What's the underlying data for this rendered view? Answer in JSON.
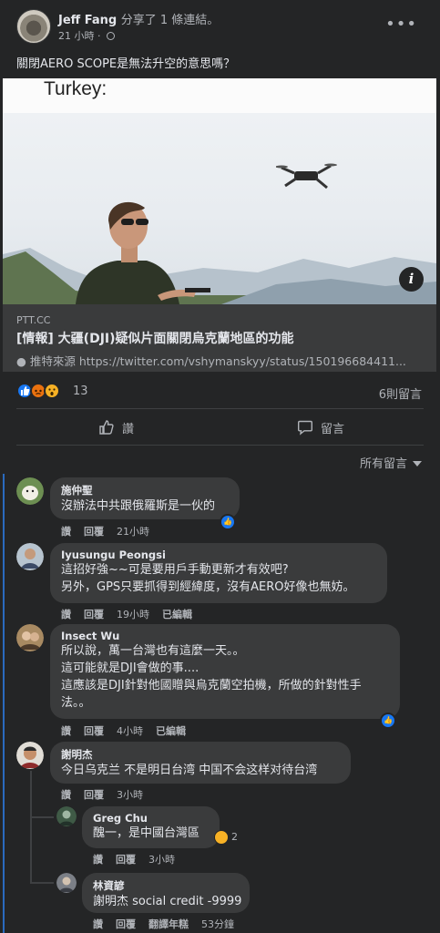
{
  "post": {
    "author": "Jeff Fang",
    "shared_text": "分享了 1 條連結。",
    "time": "21 小時",
    "text": "關閉AERO SCOPE是無法升空的意思嗎？"
  },
  "link": {
    "image_caption": "Turkey:",
    "domain": "PTT.CC",
    "title": "[情報] 大疆(DJI)疑似片面關閉烏克蘭地區的功能",
    "description": "● 推特來源 https://twitter.com/vshymanskyy/status/150196684411..."
  },
  "stats": {
    "reaction_count": "13",
    "comment_count": "6則留言"
  },
  "actions": {
    "like_label": "讚",
    "comment_label": "留言",
    "sort_label": "所有留言"
  },
  "comments": [
    {
      "name": "施仲聖",
      "lines": [
        "沒辦法中共跟俄羅斯是一伙的"
      ],
      "like": "讚",
      "reply": "回覆",
      "time": "21小時"
    },
    {
      "name": "Iyusungu Peongsi",
      "lines": [
        "這招好強~~可是要用戶手動更新才有效吧?",
        "另外，GPS只要抓得到經緯度，沒有AERO好像也無妨。"
      ],
      "like": "讚",
      "reply": "回覆",
      "time": "19小時",
      "edited": "已編輯"
    },
    {
      "name": "Insect Wu",
      "lines": [
        "所以說，萬一台灣也有這麼一天。。",
        "這可能就是DJI會做的事....",
        "這應該是DJI針對他國贈與烏克蘭空拍機，所做的針對性手",
        "法。。"
      ],
      "like": "讚",
      "reply": "回覆",
      "time": "4小時",
      "edited": "已編輯"
    },
    {
      "name": "謝明杰",
      "lines": [
        "今日乌克兰 不是明日台湾 中国不会这样对待台湾"
      ],
      "like": "讚",
      "reply": "回覆",
      "time": "3小時"
    },
    {
      "name": "Greg Chu",
      "lines": [
        "醜一，是中國台灣區"
      ],
      "like": "讚",
      "reply": "回覆",
      "time": "3小時",
      "reaction_count": "2"
    },
    {
      "name": "林資諺",
      "lines": [
        "謝明杰 social credit -9999"
      ],
      "like": "讚",
      "reply": "回覆",
      "translate": "翻譯年糕",
      "time": "53分鐘"
    }
  ],
  "colors": {
    "background": "#242526",
    "bubble": "#3a3b3c",
    "accent": "#1877f2",
    "text": "#e4e6eb",
    "secondary_text": "#b0b3b8"
  },
  "icons": {
    "more": "more-horizontal-icon",
    "privacy": "globe-icon",
    "info": "info-icon",
    "like": "thumbs-up-icon",
    "comment": "speech-bubble-icon",
    "sort": "caret-down-icon"
  }
}
